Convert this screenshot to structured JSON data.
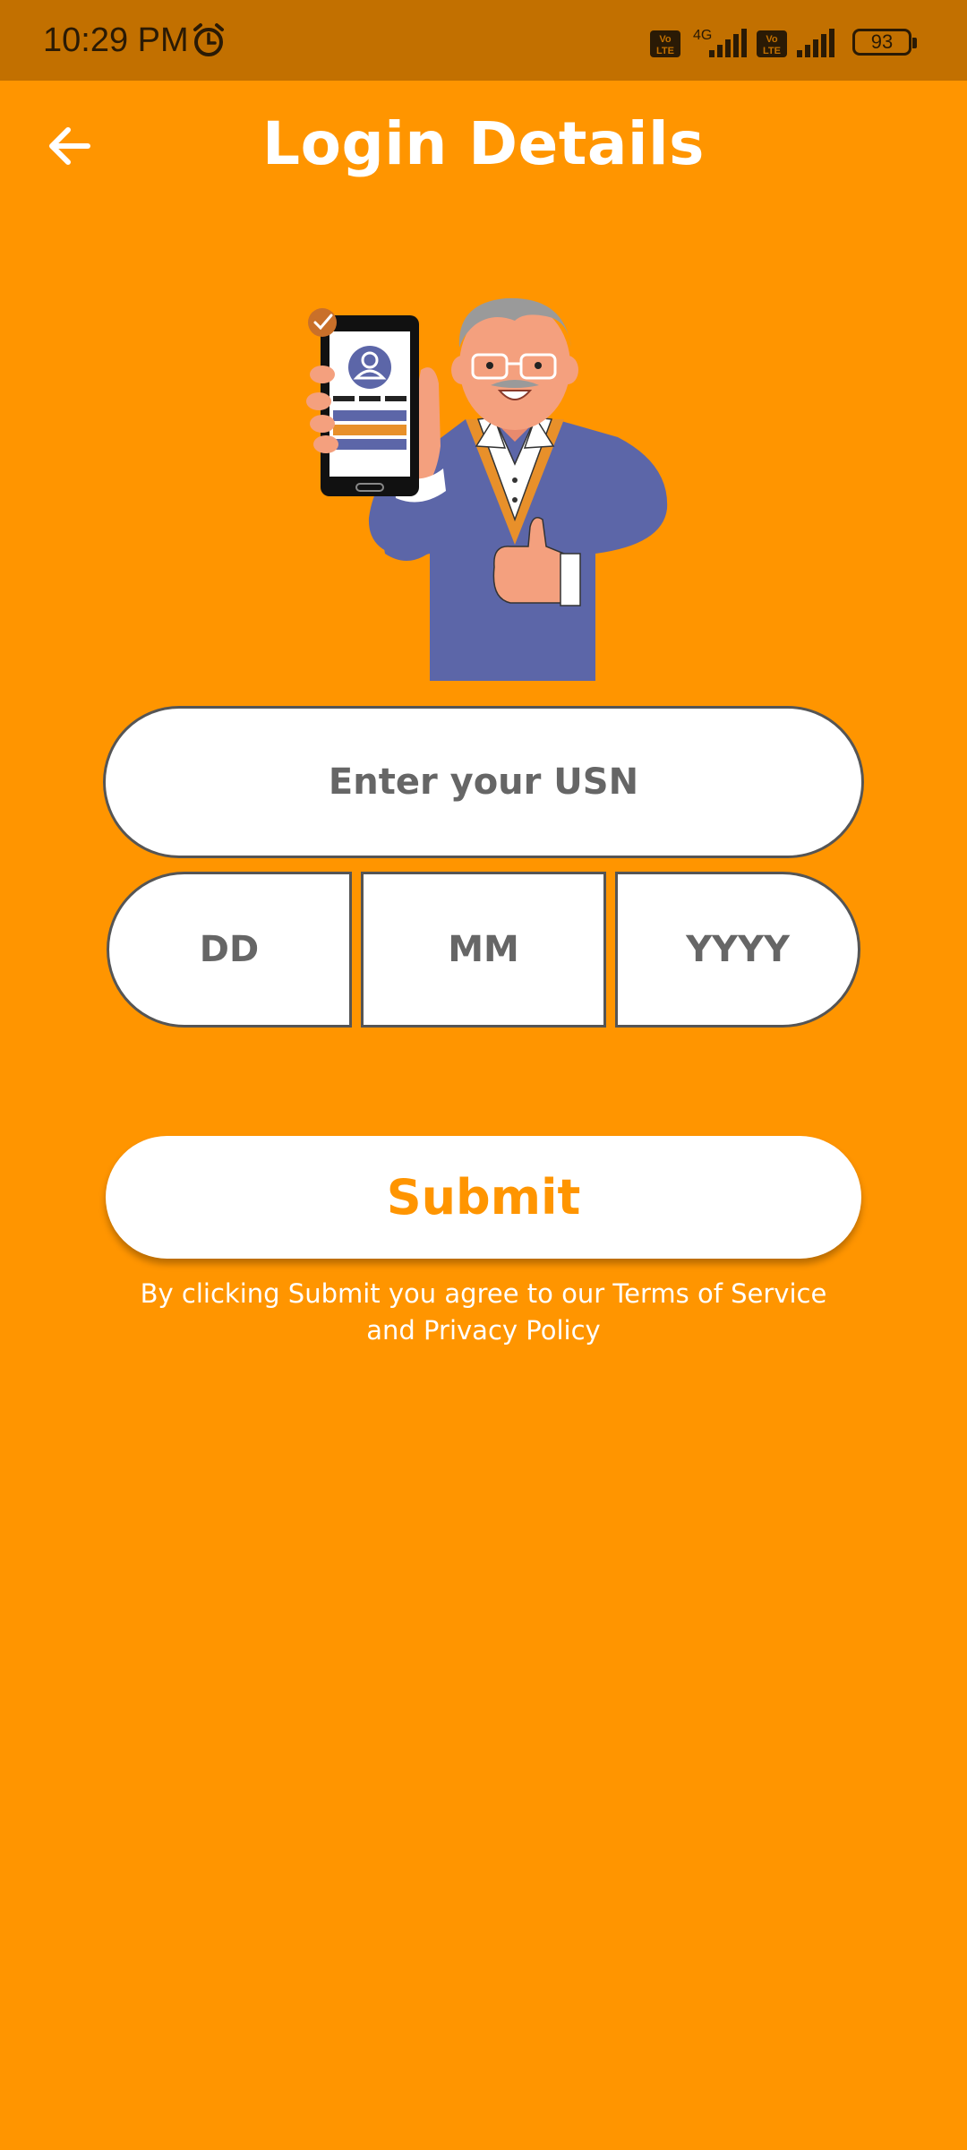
{
  "status_bar": {
    "time": "10:29 PM",
    "battery": "93",
    "icons": [
      "alarm-icon",
      "volte-icon",
      "4g-signal-icon",
      "volte-icon",
      "signal-icon",
      "battery-icon"
    ]
  },
  "header": {
    "title": "Login Details",
    "back_icon": "arrow-left-icon"
  },
  "form": {
    "usn_placeholder": "Enter your USN",
    "usn_value": "",
    "dob": {
      "day_placeholder": "DD",
      "month_placeholder": "MM",
      "year_placeholder": "YYYY"
    },
    "submit_label": "Submit",
    "terms_line1": "By clicking Submit you agree to our Terms of Service",
    "terms_line2": "and Privacy Policy"
  },
  "colors": {
    "background": "#FF9500",
    "status_bar": "#C27000",
    "accent": "#FF9500",
    "field_border": "#555555",
    "placeholder": "#666666"
  }
}
